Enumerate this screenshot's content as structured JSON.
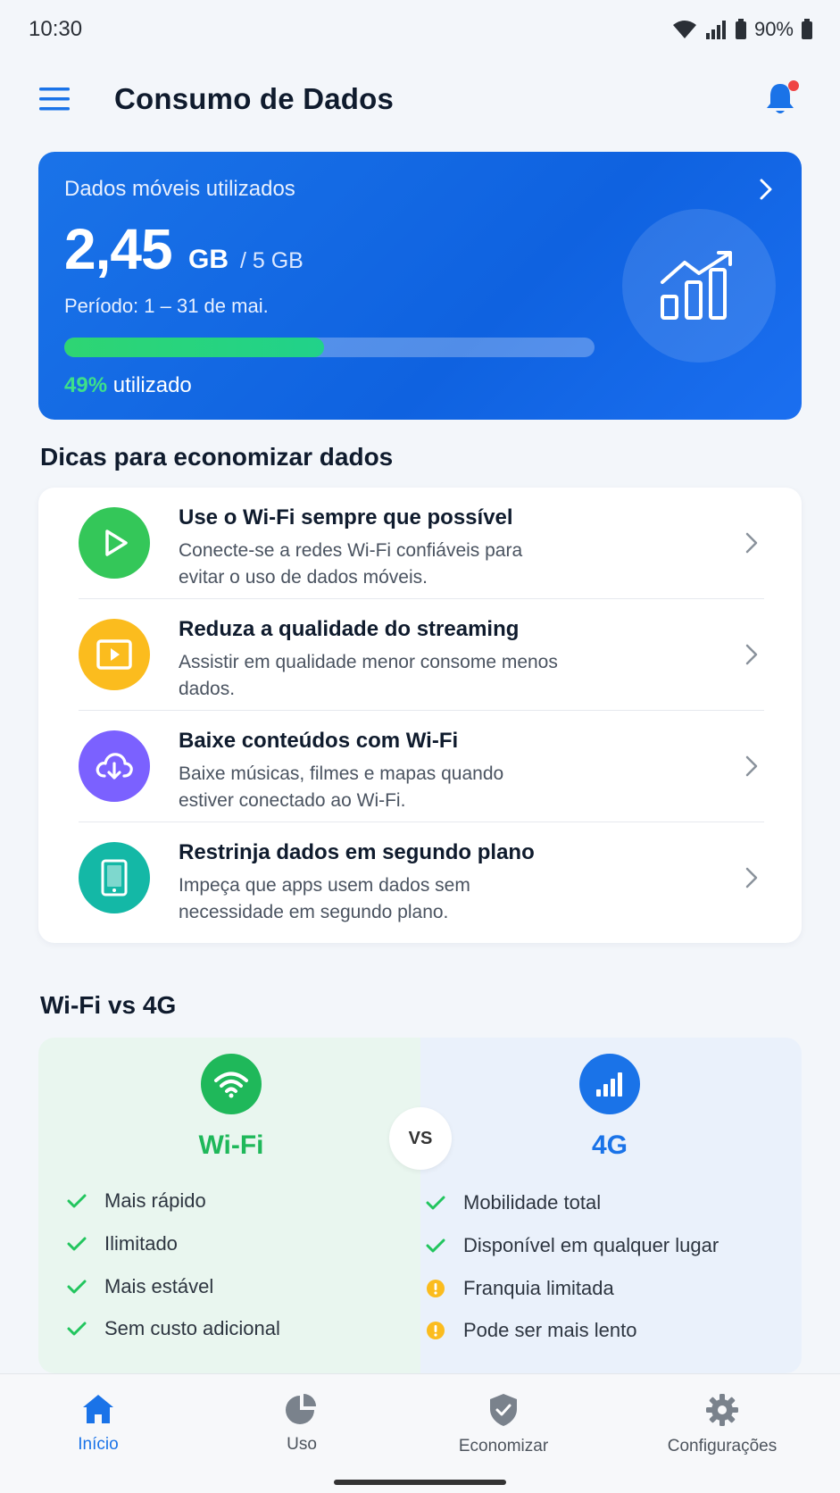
{
  "status_bar": {
    "time": "10:30",
    "battery": "90%"
  },
  "app_bar": {
    "title": "Consumo de Dados"
  },
  "usage": {
    "label": "Dados móveis utilizados",
    "value": "2,45",
    "unit": "GB",
    "limit": "/ 5 GB",
    "period": "Período: 1 – 31 de mai.",
    "percent": "49%",
    "percent_suffix": " utilizado",
    "progress_fraction": 0.49
  },
  "tips": {
    "title": "Dicas para economizar dados",
    "items": [
      {
        "title": "Use o Wi-Fi sempre que possível",
        "desc": "Conecte-se a redes Wi-Fi confiáveis para evitar o uso de dados móveis.",
        "icon": "play-icon",
        "color": "#34c759"
      },
      {
        "title": "Reduza a qualidade do streaming",
        "desc": "Assistir em qualidade menor consome menos dados.",
        "icon": "video-icon",
        "color": "#fbbc1e"
      },
      {
        "title": "Baixe conteúdos com Wi-Fi",
        "desc": "Baixe músicas, filmes e mapas quando estiver conectado ao Wi-Fi.",
        "icon": "cloud-download-icon",
        "color": "#7b61ff"
      },
      {
        "title": "Restrinja dados em segundo plano",
        "desc": "Impeça que apps usem dados sem necessidade em segundo plano.",
        "icon": "phone-icon",
        "color": "#14b8a6"
      }
    ]
  },
  "comparison": {
    "title": "Wi-Fi vs 4G",
    "vs": "VS",
    "wifi": {
      "name": "Wi-Fi",
      "color": "#1fb85a",
      "features": [
        "Mais rápido",
        "Ilimitado",
        "Mais estável",
        "Sem custo adicional"
      ]
    },
    "mobile": {
      "name": "4G",
      "color": "#1a73e8",
      "features": [
        {
          "text": "Mobilidade total",
          "type": "check"
        },
        {
          "text": "Disponível em qualquer lugar",
          "type": "check"
        },
        {
          "text": "Franquia limitada",
          "type": "warning"
        },
        {
          "text": "Pode ser mais lento",
          "type": "warning"
        }
      ]
    }
  },
  "bottom_nav": {
    "items": [
      {
        "label": "Início",
        "icon": "home-icon",
        "active": true
      },
      {
        "label": "Uso",
        "icon": "pie-chart-icon",
        "active": false
      },
      {
        "label": "Economizar",
        "icon": "shield-icon",
        "active": false
      },
      {
        "label": "Configurações",
        "icon": "gear-icon",
        "active": false
      }
    ]
  }
}
